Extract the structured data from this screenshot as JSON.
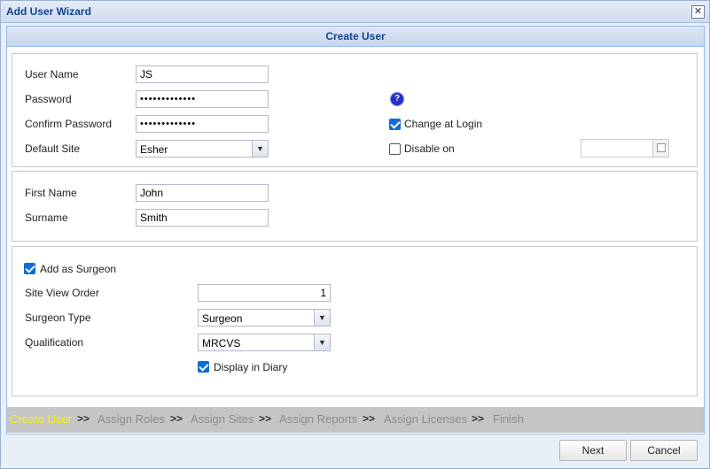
{
  "window": {
    "title": "Add User Wizard",
    "close_glyph": "✕"
  },
  "panel": {
    "title": "Create User"
  },
  "account": {
    "username_label": "User Name",
    "username_value": "JS",
    "password_label": "Password",
    "password_value": "•••••••••••••",
    "confirm_label": "Confirm Password",
    "confirm_value": "•••••••••••••",
    "site_label": "Default Site",
    "site_value": "Esher",
    "help_glyph": "?",
    "change_at_login_label": "Change at Login",
    "change_at_login_checked": true,
    "disable_on_label": "Disable on",
    "disable_on_checked": false,
    "disable_on_date": ""
  },
  "person": {
    "first_name_label": "First Name",
    "first_name_value": "John",
    "surname_label": "Surname",
    "surname_value": "Smith"
  },
  "surgeon": {
    "add_label": "Add as Surgeon",
    "add_checked": true,
    "view_order_label": "Site View Order",
    "view_order_value": "1",
    "type_label": "Surgeon Type",
    "type_value": "Surgeon",
    "qualification_label": "Qualification",
    "qualification_value": "MRCVS",
    "diary_label": "Display in Diary",
    "diary_checked": true
  },
  "steps": {
    "items": [
      "Create User",
      "Assign Roles",
      "Assign Sites",
      "Assign Reports",
      "Assign Licenses",
      "Finish"
    ],
    "separator": ">>",
    "active_index": 0
  },
  "buttons": {
    "next": "Next",
    "cancel": "Cancel"
  },
  "icons": {
    "dropdown": "chevron-down-icon",
    "help": "help-icon",
    "calendar": "calendar-icon",
    "close": "close-icon"
  },
  "colors": {
    "accent": "#15428b",
    "active_step": "#f5f500",
    "checkbox": "#0f6cd3"
  }
}
